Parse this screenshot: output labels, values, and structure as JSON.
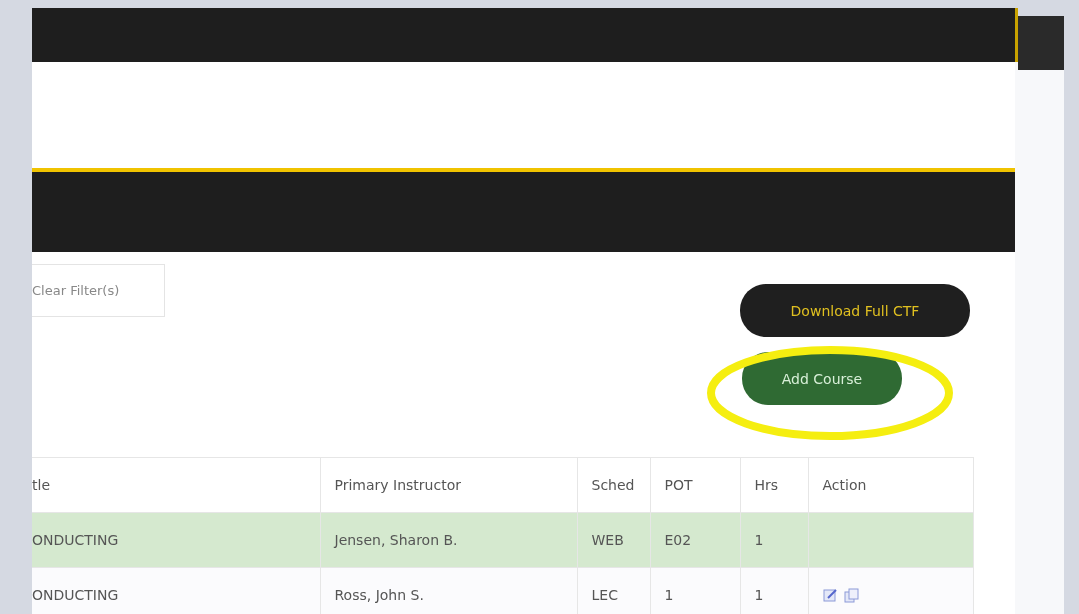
{
  "filter_button": {
    "label": "Clear Filter(s)"
  },
  "buttons": [
    {
      "label": "Download Full CTF",
      "kind": "dark"
    },
    {
      "label": "Add Course",
      "kind": "green"
    }
  ],
  "table": {
    "columns": [
      "tle",
      "Primary Instructor",
      "Sched",
      "POT",
      "Hrs",
      "Action"
    ],
    "rows": [
      {
        "cells": [
          "ONDUCTING",
          "Jensen, Sharon B.",
          "WEB",
          "E02",
          "1"
        ],
        "highlighted": true,
        "has_actions": false
      },
      {
        "cells": [
          "ONDUCTING",
          "Ross, John S.",
          "LEC",
          "1",
          "1"
        ],
        "highlighted": false,
        "has_actions": true
      }
    ]
  }
}
